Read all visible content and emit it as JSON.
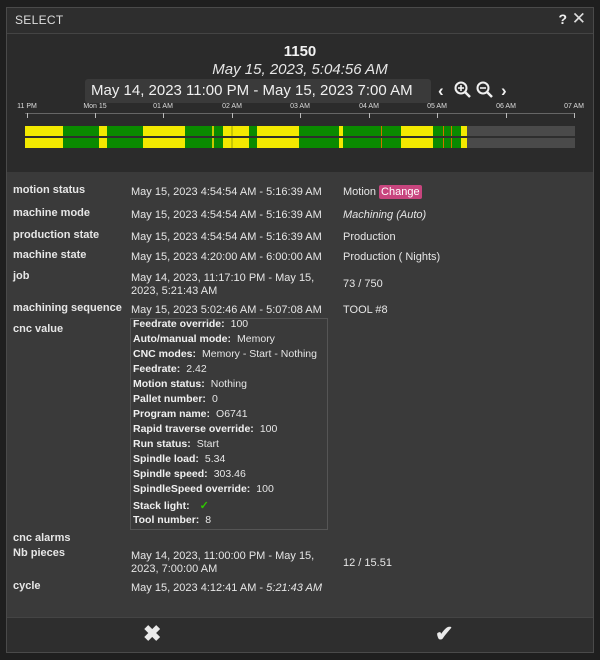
{
  "dialog": {
    "title": "SELECT",
    "help_label": "?",
    "close_label": "✕"
  },
  "header": {
    "id": "1150",
    "datetime": "May 15, 2023, 5:04:56 AM",
    "range": "May 14, 2023 11:00 PM - May 15, 2023 7:00 AM",
    "icons": [
      "chevron-left-icon",
      "zoom-in-icon",
      "zoom-out-icon",
      "chevron-right-icon"
    ]
  },
  "timeline": {
    "ticks": [
      "11 PM",
      "Mon 15",
      "01 AM",
      "02 AM",
      "03 AM",
      "04 AM",
      "05 AM",
      "06 AM",
      "07 AM"
    ],
    "colors": {
      "yellow": "#f3e900",
      "green": "#0a8a00",
      "empty": "#4a4a4a"
    }
  },
  "details": {
    "motion_status": {
      "label": "motion status",
      "value": "May 15, 2023 4:54:54 AM - 5:16:39 AM",
      "extra": "Motion",
      "action": "Change"
    },
    "machine_mode": {
      "label": "machine mode",
      "value": "May 15, 2023 4:54:54 AM - 5:16:39 AM",
      "extra": "Machining (Auto)"
    },
    "production_state": {
      "label": "production state",
      "value": "May 15, 2023 4:54:54 AM - 5:16:39 AM",
      "extra": "Production"
    },
    "machine_state": {
      "label": "machine state",
      "value": "May 15, 2023 4:20:00 AM - 6:00:00 AM",
      "extra": "Production ( Nights)"
    },
    "job": {
      "label": "job",
      "value_line1": "May 14, 2023, 11:17:10 PM - May 15,",
      "value_line2": "2023, 5:21:43 AM",
      "extra": "73 / 750"
    },
    "machining_sequence": {
      "label": "machining sequence",
      "value": "May 15, 2023 5:02:46 AM - 5:07:08 AM",
      "extra": "TOOL #8"
    },
    "cnc_value": {
      "label": "cnc value",
      "items": [
        {
          "key": "Feedrate override:",
          "val": "100"
        },
        {
          "key": "Auto/manual mode:",
          "val": "Memory"
        },
        {
          "key": "CNC modes:",
          "val": "Memory - Start - Nothing"
        },
        {
          "key": "Feedrate:",
          "val": "2.42"
        },
        {
          "key": "Motion status:",
          "val": "Nothing"
        },
        {
          "key": "Pallet number:",
          "val": "0"
        },
        {
          "key": "Program name:",
          "val": "O6741"
        },
        {
          "key": "Rapid traverse override:",
          "val": "100"
        },
        {
          "key": "Run status:",
          "val": "Start"
        },
        {
          "key": "Spindle load:",
          "val": "5.34"
        },
        {
          "key": "Spindle speed:",
          "val": "303.46"
        },
        {
          "key": "SpindleSpeed override:",
          "val": "100"
        },
        {
          "key": "Stack light:",
          "val": "✓"
        },
        {
          "key": "Tool number:",
          "val": "8"
        }
      ]
    },
    "cnc_alarms": {
      "label": "cnc alarms"
    },
    "nb_pieces": {
      "label": "Nb pieces",
      "value_line1": "May 14, 2023, 11:00:00 PM - May 15,",
      "value_line2": "2023, 7:00:00 AM",
      "extra": "12 / 15.51"
    },
    "cycle": {
      "label": "cycle",
      "value_start": "May 15, 2023 4:12:41 AM - ",
      "value_end": "5:21:43 AM"
    }
  },
  "footer": {
    "cancel_label": "✖",
    "confirm_label": "✔"
  }
}
